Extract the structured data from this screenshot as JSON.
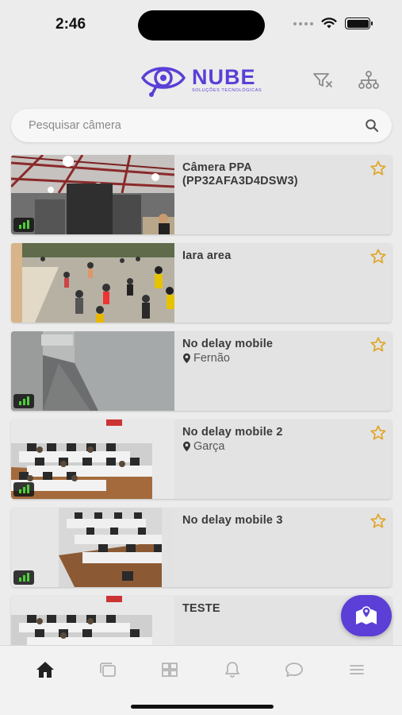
{
  "status_bar": {
    "time": "2:46"
  },
  "brand": {
    "name": "NUBE",
    "tagline": "SOLUÇÕES TECNOLÓGICAS",
    "color": "#5b3fd6"
  },
  "search": {
    "placeholder": "Pesquisar câmera",
    "value": ""
  },
  "cameras": [
    {
      "name": "Câmera PPA (PP32AFA3D4DSW3)",
      "location": "",
      "favorite_icon": "star-outline-icon",
      "signal_badge": true
    },
    {
      "name": "Iara area",
      "location": "",
      "favorite_icon": "star-outline-icon",
      "signal_badge": false
    },
    {
      "name": "No delay mobile",
      "location": "Fernão",
      "favorite_icon": "star-outline-icon",
      "signal_badge": true
    },
    {
      "name": "No delay mobile 2",
      "location": "Garça",
      "favorite_icon": "star-outline-icon",
      "signal_badge": true
    },
    {
      "name": "No delay mobile 3",
      "location": "",
      "favorite_icon": "star-outline-icon",
      "signal_badge": true
    },
    {
      "name": "TESTE",
      "location": "",
      "favorite_icon": "star-outline-icon",
      "signal_badge": false
    }
  ],
  "bottom_nav": [
    "home-icon",
    "copy-icon",
    "grid-icon",
    "bell-icon",
    "chat-icon",
    "menu-icon"
  ],
  "colors": {
    "accent": "#5b3fd6",
    "star": "#e0a82e",
    "signal": "#4cd137"
  }
}
